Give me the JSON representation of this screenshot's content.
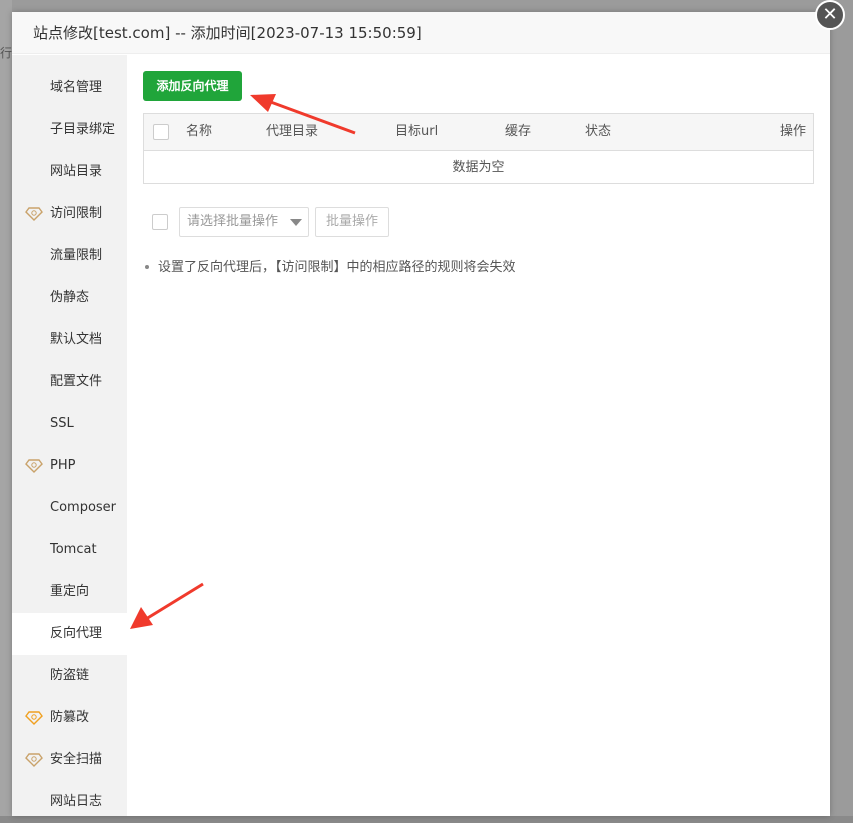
{
  "background": {
    "fragment_text": "行版"
  },
  "dialog": {
    "title": "站点修改[test.com] -- 添加时间[2023-07-13 15:50:59]",
    "close_symbol": "✕"
  },
  "sidebar": {
    "items": [
      {
        "label": "域名管理",
        "gem": false,
        "active": false
      },
      {
        "label": "子目录绑定",
        "gem": false,
        "active": false
      },
      {
        "label": "网站目录",
        "gem": false,
        "active": false
      },
      {
        "label": "访问限制",
        "gem": true,
        "gem_color": "#c9a26a",
        "active": false
      },
      {
        "label": "流量限制",
        "gem": false,
        "active": false
      },
      {
        "label": "伪静态",
        "gem": false,
        "active": false
      },
      {
        "label": "默认文档",
        "gem": false,
        "active": false
      },
      {
        "label": "配置文件",
        "gem": false,
        "active": false
      },
      {
        "label": "SSL",
        "gem": false,
        "active": false
      },
      {
        "label": "PHP",
        "gem": true,
        "gem_color": "#c9a26a",
        "active": false
      },
      {
        "label": "Composer",
        "gem": false,
        "active": false
      },
      {
        "label": "Tomcat",
        "gem": false,
        "active": false
      },
      {
        "label": "重定向",
        "gem": false,
        "active": false
      },
      {
        "label": "反向代理",
        "gem": false,
        "active": true
      },
      {
        "label": "防盗链",
        "gem": false,
        "active": false
      },
      {
        "label": "防篡改",
        "gem": true,
        "gem_color": "#f0a020",
        "active": false
      },
      {
        "label": "安全扫描",
        "gem": true,
        "gem_color": "#c9a26a",
        "active": false
      },
      {
        "label": "网站日志",
        "gem": false,
        "active": false
      }
    ]
  },
  "main": {
    "add_button": "添加反向代理",
    "table": {
      "columns": [
        "名称",
        "代理目录",
        "目标url",
        "缓存",
        "状态",
        "操作"
      ],
      "empty_text": "数据为空"
    },
    "batch": {
      "select_placeholder": "请选择批量操作",
      "button": "批量操作"
    },
    "tip": "设置了反向代理后，【访问限制】中的相应路径的规则将会失效"
  },
  "colors": {
    "accent": "#20a53a",
    "arrow": "#f03a2c"
  }
}
